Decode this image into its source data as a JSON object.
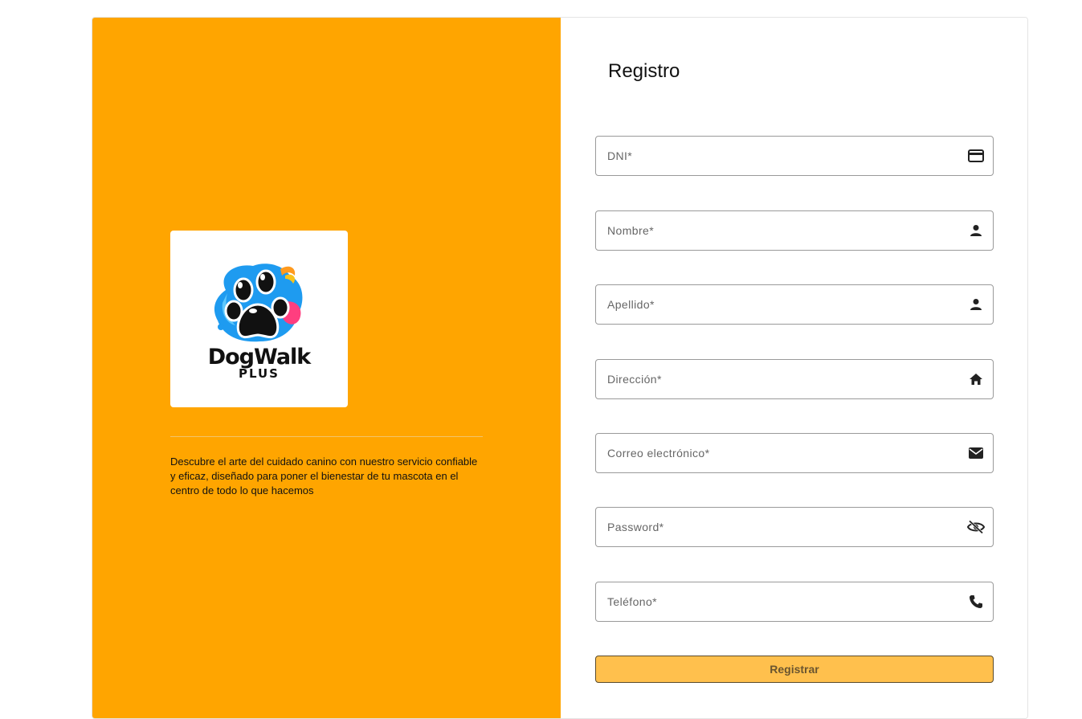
{
  "brand": {
    "logo_word": "DogWalk",
    "logo_sub": "PLUS",
    "description": "Descubre el arte del cuidado canino con nuestro servicio confiable y eficaz, diseñado para poner el bienestar de tu mascota en el centro de todo lo que hacemos"
  },
  "form": {
    "title": "Registro",
    "fields": [
      {
        "label": "DNI*",
        "icon": "credit-card-icon"
      },
      {
        "label": "Nombre*",
        "icon": "person-icon"
      },
      {
        "label": "Apellido*",
        "icon": "person-icon"
      },
      {
        "label": "Dirección*",
        "icon": "home-icon"
      },
      {
        "label": "Correo electrónico*",
        "icon": "mail-icon"
      },
      {
        "label": "Password*",
        "icon": "eye-off-icon"
      },
      {
        "label": "Teléfono*",
        "icon": "phone-icon"
      }
    ],
    "submit_label": "Registrar"
  },
  "colors": {
    "accent": "#FFA500",
    "button": "#FFC04D"
  }
}
